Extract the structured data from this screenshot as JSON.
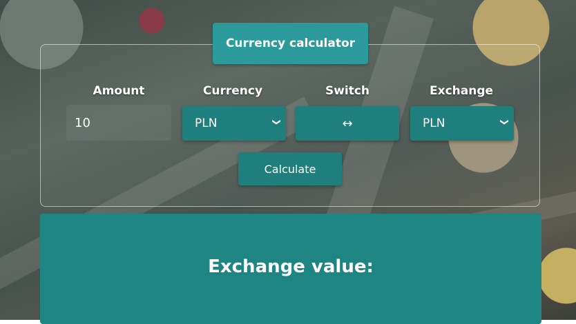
{
  "header": {
    "title": "Currency calculator"
  },
  "form": {
    "labels": {
      "amount": "Amount",
      "currency": "Currency",
      "switch": "Switch",
      "exchange": "Exchange"
    },
    "amount_value": "10",
    "currency_selected": "PLN",
    "exchange_selected": "PLN",
    "switch_symbol": "↔",
    "calculate_label": "Calculate"
  },
  "result": {
    "title": "Exchange value:"
  },
  "colors": {
    "accent": "#2a9a9a",
    "control": "#1f7f7d",
    "result_bg": "#1f8583"
  },
  "icons": {
    "dropdown": "chevron-down-icon",
    "switch": "swap-arrows-icon"
  }
}
